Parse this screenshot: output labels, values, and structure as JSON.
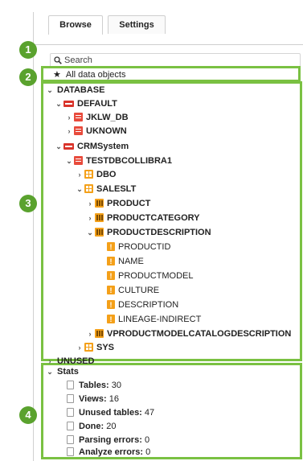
{
  "tabs": [
    {
      "label": "Browse",
      "active": true
    },
    {
      "label": "Settings",
      "active": false
    }
  ],
  "search": {
    "placeholder": "Search"
  },
  "all_objects": {
    "star": "★",
    "label": "All data objects"
  },
  "callouts": [
    "1",
    "2",
    "3",
    "4"
  ],
  "tree": {
    "database": "DATABASE",
    "default": "DEFAULT",
    "jklw_db": "JKLW_DB",
    "uknown": "UKNOWN",
    "crmsystem": "CRMSystem",
    "testdbcollibra1": "TESTDBCOLLIBRA1",
    "dbo": "DBO",
    "saleslt": "SALESLT",
    "product": "PRODUCT",
    "productcategory": "PRODUCTCATEGORY",
    "productdescription": "PRODUCTDESCRIPTION",
    "columns": [
      "PRODUCTID",
      "NAME",
      "PRODUCTMODEL",
      "CULTURE",
      "DESCRIPTION",
      "LINEAGE-INDIRECT"
    ],
    "vproductmodel": "VPRODUCTMODELCATALOGDESCRIPTION",
    "sys": "SYS",
    "unused": "UNUSED"
  },
  "stats": {
    "title": "Stats",
    "items": [
      {
        "label": "Tables:",
        "value": "30"
      },
      {
        "label": "Views:",
        "value": "16"
      },
      {
        "label": "Unused tables:",
        "value": "47"
      },
      {
        "label": "Done:",
        "value": "20"
      },
      {
        "label": "Parsing errors:",
        "value": "0"
      },
      {
        "label": "Analyze errors:",
        "value": "0"
      }
    ]
  },
  "colors": {
    "highlight": "#7ac142",
    "badge": "#5aa22e",
    "db_icon": "#e84b3c",
    "schema_icon": "#f4a019"
  }
}
